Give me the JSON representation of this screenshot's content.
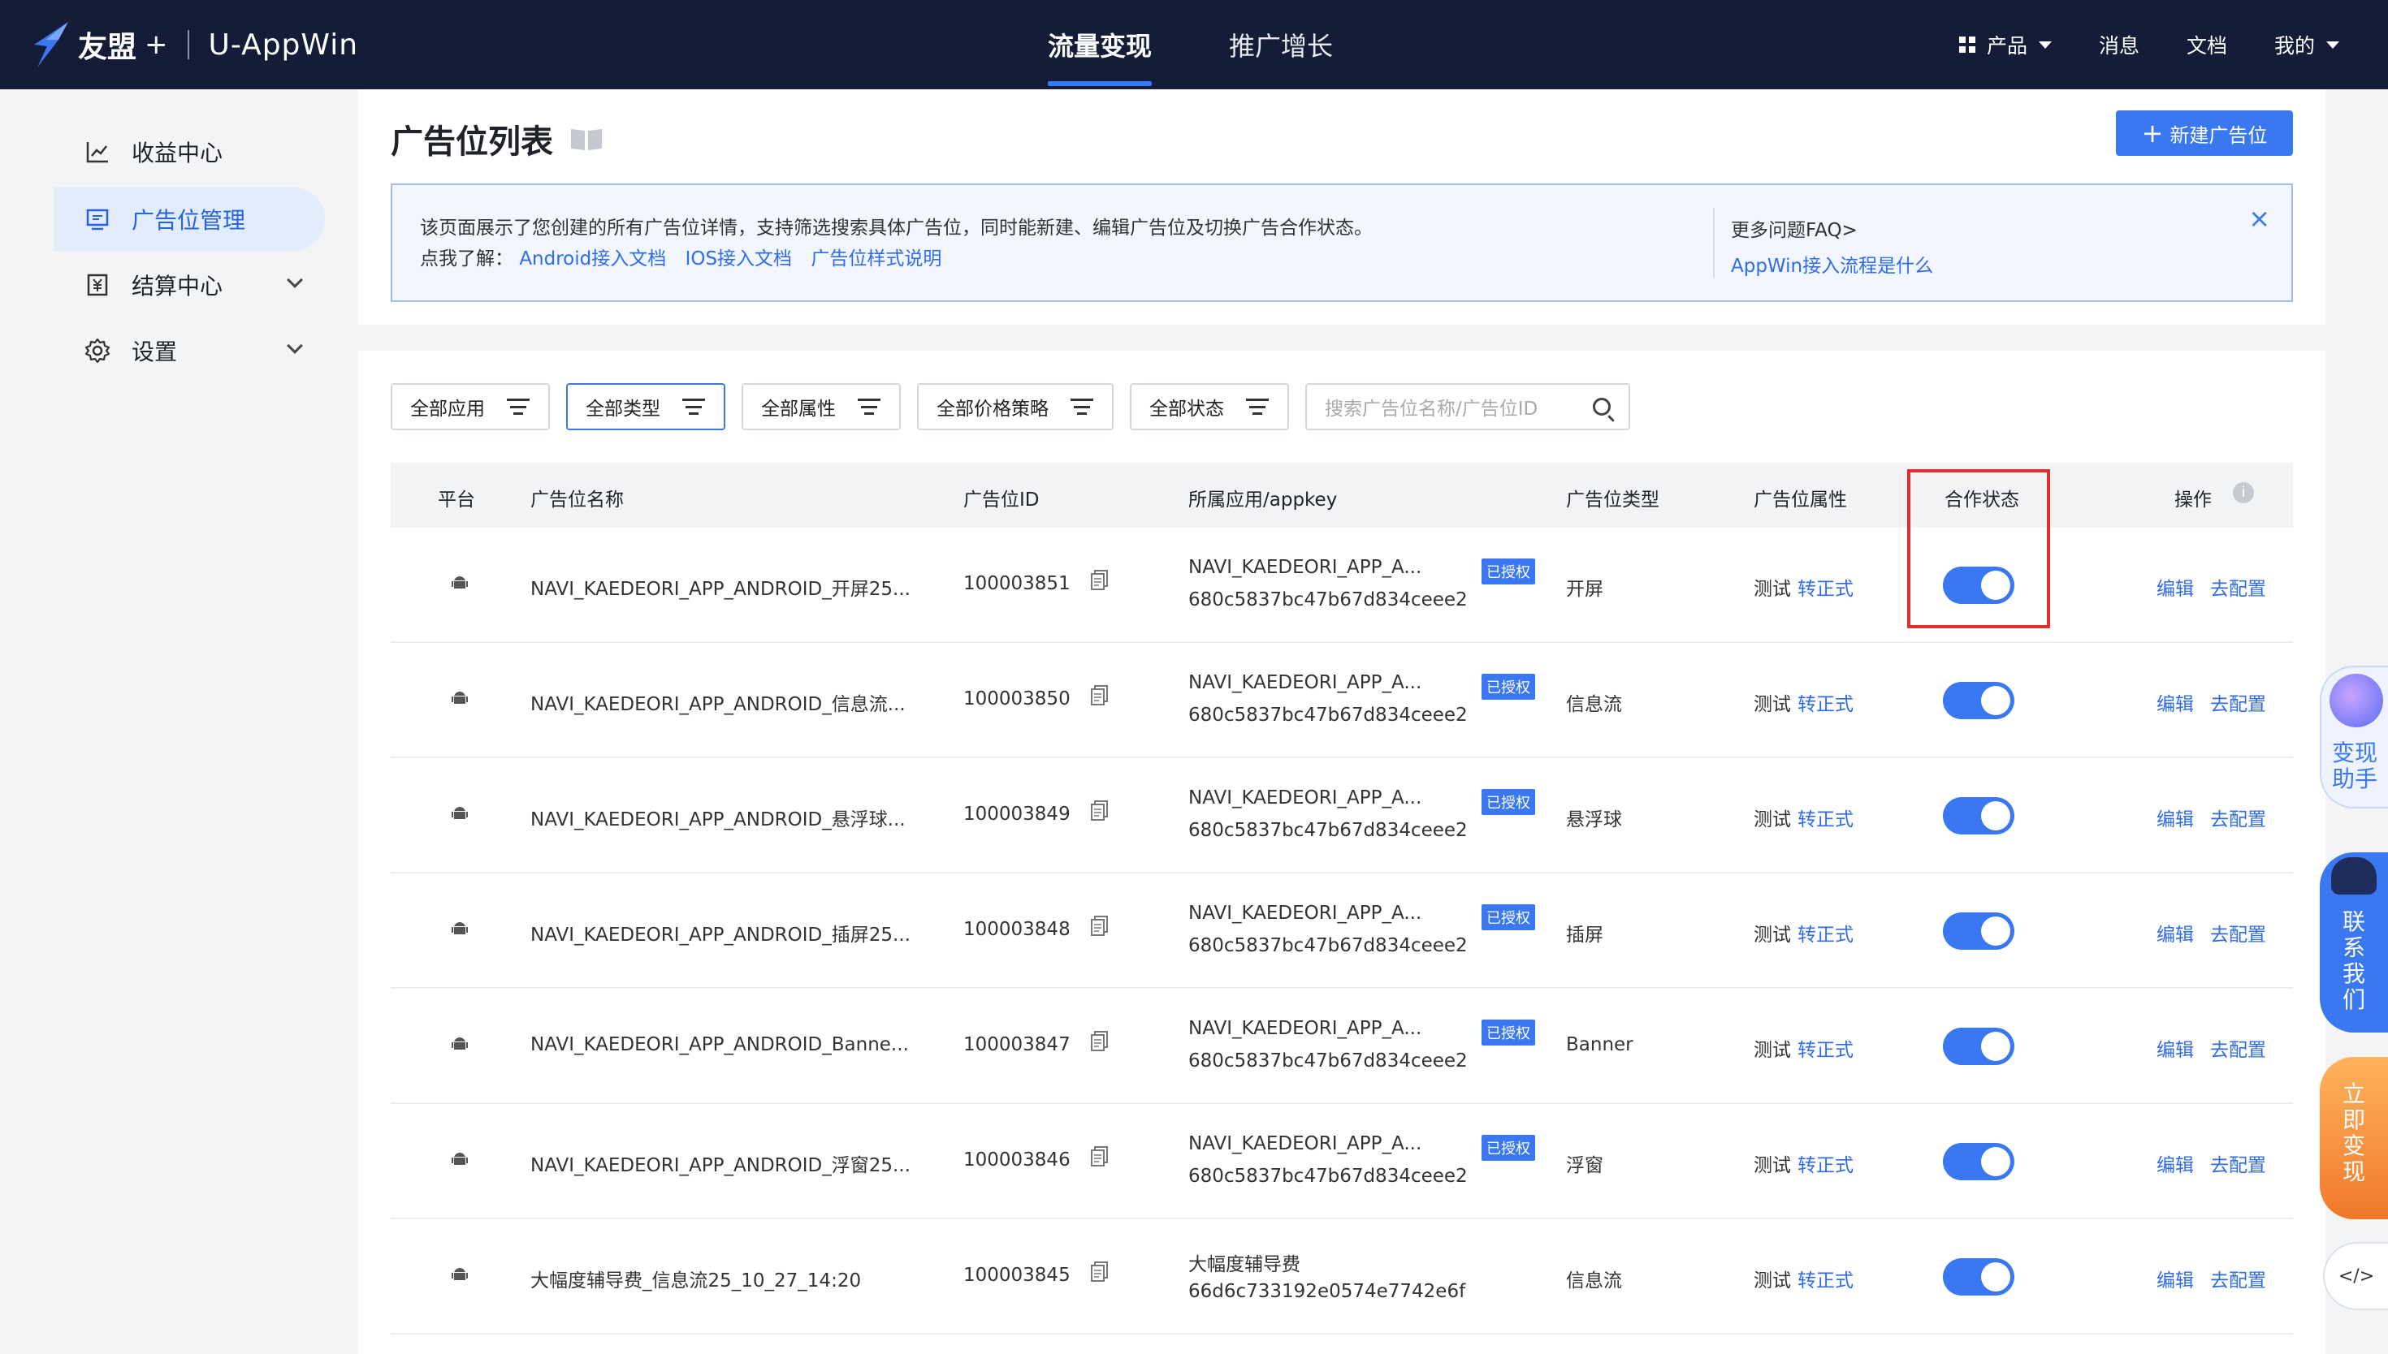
{
  "topbar": {
    "brand": "友盟",
    "plus": "+",
    "product": "U-AppWin",
    "tabs": [
      {
        "label": "流量变现",
        "active": true
      },
      {
        "label": "推广增长",
        "active": false
      }
    ],
    "right": {
      "products": "产品",
      "messages": "消息",
      "docs": "文档",
      "mine": "我的"
    }
  },
  "sidebar": {
    "items": [
      {
        "label": "收益中心",
        "icon": "chart-line-icon"
      },
      {
        "label": "广告位管理",
        "icon": "monitor-icon",
        "active": true
      },
      {
        "label": "结算中心",
        "icon": "yuan-icon"
      },
      {
        "label": "设置",
        "icon": "gear-icon"
      }
    ]
  },
  "header": {
    "title": "广告位列表",
    "new_button": "新建广告位",
    "notice": {
      "line1": "该页面展示了您创建的所有广告位详情，支持筛选搜索具体广告位，同时能新建、编辑广告位及切换广告合作状态。",
      "line2_prefix": "点我了解：",
      "links": [
        "Android接入文档",
        "IOS接入文档",
        "广告位样式说明"
      ],
      "faq_title": "更多问题FAQ>",
      "faq_link": "AppWin接入流程是什么",
      "close": "×"
    }
  },
  "filters": {
    "items": [
      "全部应用",
      "全部类型",
      "全部属性",
      "全部价格策略",
      "全部状态"
    ],
    "search_placeholder": "搜索广告位名称/广告位ID"
  },
  "table": {
    "columns": [
      "平台",
      "广告位名称",
      "广告位ID",
      "所属应用/appkey",
      "广告位类型",
      "广告位属性",
      "合作状态",
      "操作"
    ],
    "attr_test": "测试",
    "attr_link": "转正式",
    "badge": "已授权",
    "op_edit": "编辑",
    "op_config": "去配置",
    "rows": [
      {
        "name": "NAVI_KAEDEORI_APP_ANDROID_开屏25...",
        "id": "100003851",
        "app": "NAVI_KAEDEORI_APP_A...",
        "appkey": "680c5837bc47b67d834ceee2",
        "authorized": true,
        "type": "开屏",
        "enabled": true
      },
      {
        "name": "NAVI_KAEDEORI_APP_ANDROID_信息流...",
        "id": "100003850",
        "app": "NAVI_KAEDEORI_APP_A...",
        "appkey": "680c5837bc47b67d834ceee2",
        "authorized": true,
        "type": "信息流",
        "enabled": true
      },
      {
        "name": "NAVI_KAEDEORI_APP_ANDROID_悬浮球...",
        "id": "100003849",
        "app": "NAVI_KAEDEORI_APP_A...",
        "appkey": "680c5837bc47b67d834ceee2",
        "authorized": true,
        "type": "悬浮球",
        "enabled": true
      },
      {
        "name": "NAVI_KAEDEORI_APP_ANDROID_插屏25...",
        "id": "100003848",
        "app": "NAVI_KAEDEORI_APP_A...",
        "appkey": "680c5837bc47b67d834ceee2",
        "authorized": true,
        "type": "插屏",
        "enabled": true
      },
      {
        "name": "NAVI_KAEDEORI_APP_ANDROID_Banne...",
        "id": "100003847",
        "app": "NAVI_KAEDEORI_APP_A...",
        "appkey": "680c5837bc47b67d834ceee2",
        "authorized": true,
        "type": "Banner",
        "enabled": true
      },
      {
        "name": "NAVI_KAEDEORI_APP_ANDROID_浮窗25...",
        "id": "100003846",
        "app": "NAVI_KAEDEORI_APP_A...",
        "appkey": "680c5837bc47b67d834ceee2",
        "authorized": true,
        "type": "浮窗",
        "enabled": true
      },
      {
        "name": "大幅度辅导费_信息流25_10_27_14:20",
        "id": "100003845",
        "app": "大幅度辅导费",
        "appkey": "66d6c733192e0574e7742e6f",
        "authorized": false,
        "type": "信息流",
        "enabled": true
      }
    ]
  },
  "floating": {
    "assistant": [
      "变现",
      "助手"
    ],
    "contact": [
      "联",
      "系",
      "我",
      "们"
    ],
    "monetize": [
      "立",
      "即",
      "变",
      "现"
    ],
    "code": "</>"
  },
  "colors": {
    "accent": "#3a78f2",
    "topbar": "#141c38",
    "highlight": "#e0302e"
  }
}
